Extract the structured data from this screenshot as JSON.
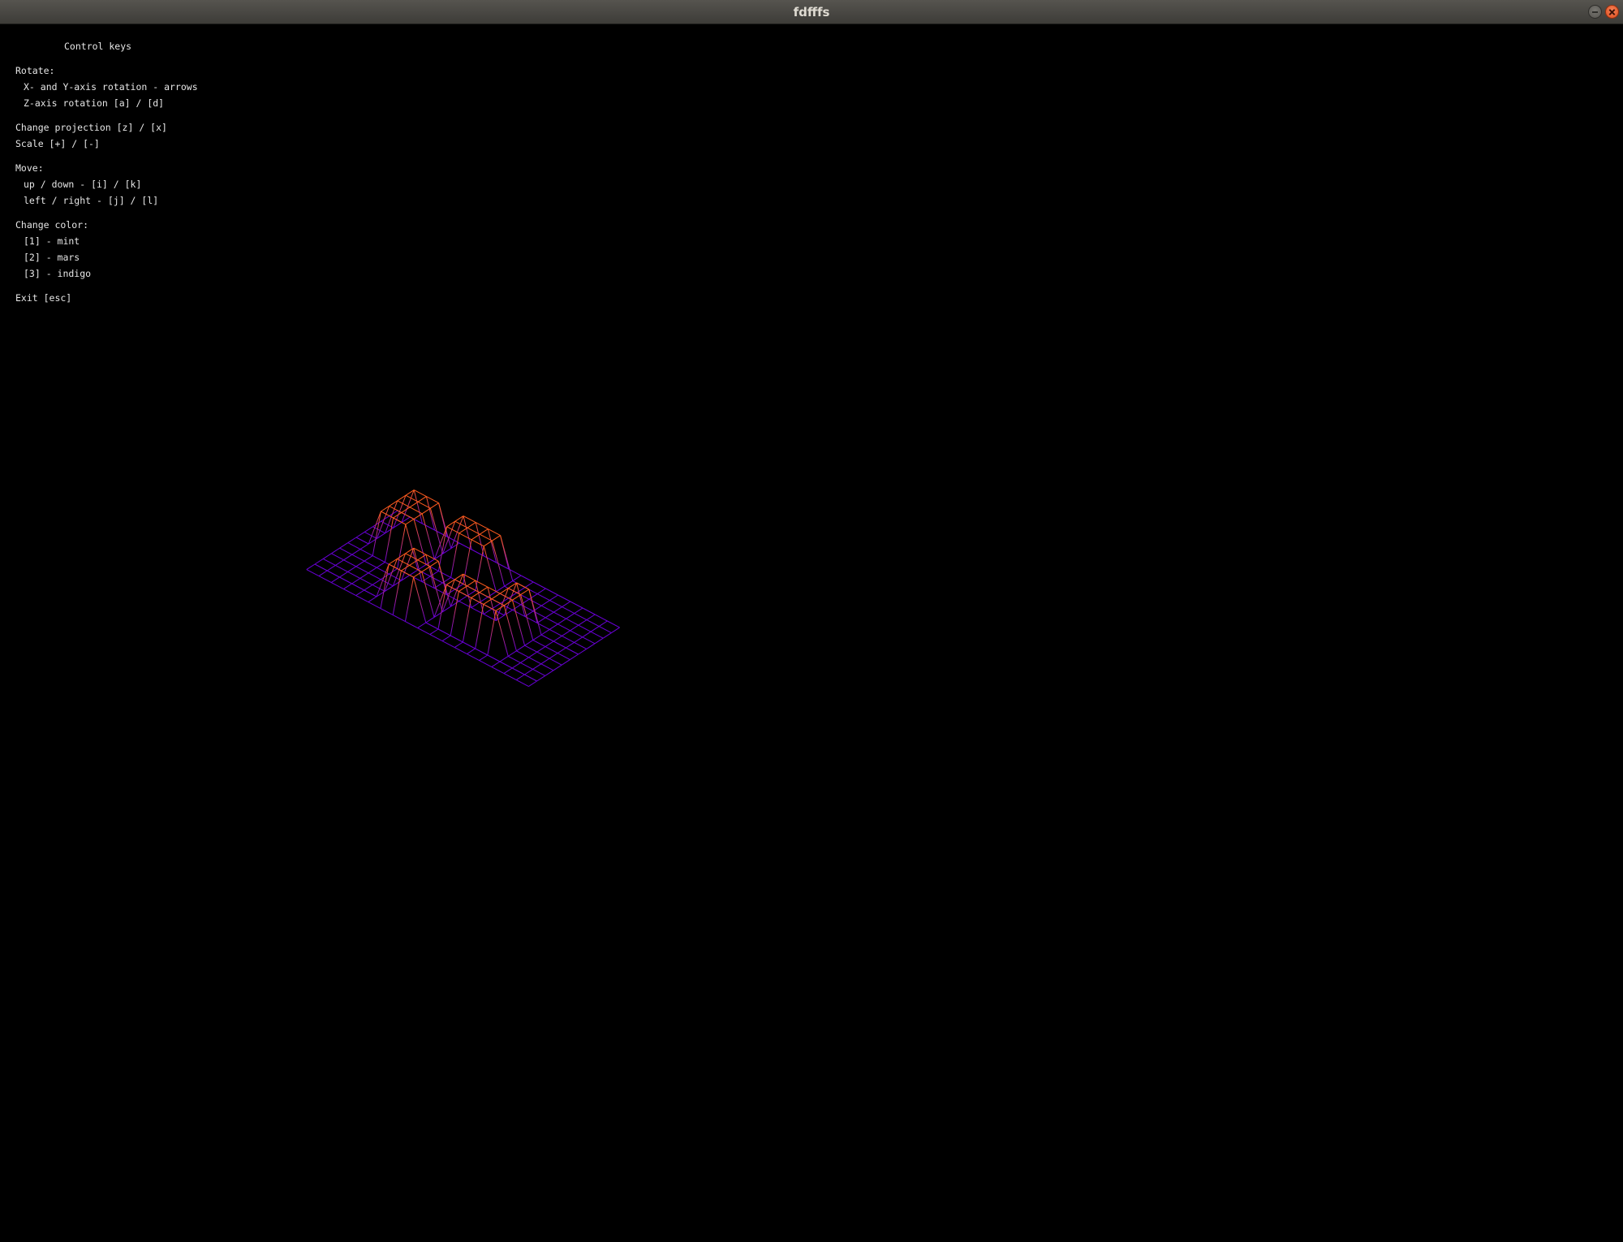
{
  "window": {
    "title": "fdfffs",
    "minimize_icon": "minimize-icon",
    "close_icon": "close-icon"
  },
  "legend": {
    "heading": "Control keys",
    "rotate_title": "Rotate:",
    "rotate_xy": "X- and Y-axis rotation - arrows",
    "rotate_z": "Z-axis rotation [a] / [d]",
    "projection": "Change projection [z] / [x]",
    "scale": "Scale [+] / [-]",
    "move_title": "Move:",
    "move_updown": "up / down - [i] / [k]",
    "move_leftright": "left / right - [j] / [l]",
    "color_title": "Change color:",
    "color_1": "[1] - mint",
    "color_2": "[2] - mars",
    "color_3": "[3] - indigo",
    "exit": "Exit [esc]"
  },
  "wireframe": {
    "rows": 12,
    "cols": 19,
    "low_color": "#6a00d8",
    "high_color": "#ff5b1e",
    "plateaus": [
      {
        "r0": 1,
        "r1": 5,
        "c0": 2,
        "c1": 4,
        "h": 10
      },
      {
        "r0": 1,
        "r1": 3,
        "c0": 6,
        "c1": 9,
        "h": 10
      },
      {
        "r0": 7,
        "r1": 10,
        "c0": 6,
        "c1": 8,
        "h": 10
      },
      {
        "r0": 7,
        "r1": 9,
        "c0": 10,
        "c1": 14,
        "h": 10
      },
      {
        "r0": 5,
        "r1": 6,
        "c0": 13,
        "c1": 14,
        "h": 10
      }
    ]
  }
}
